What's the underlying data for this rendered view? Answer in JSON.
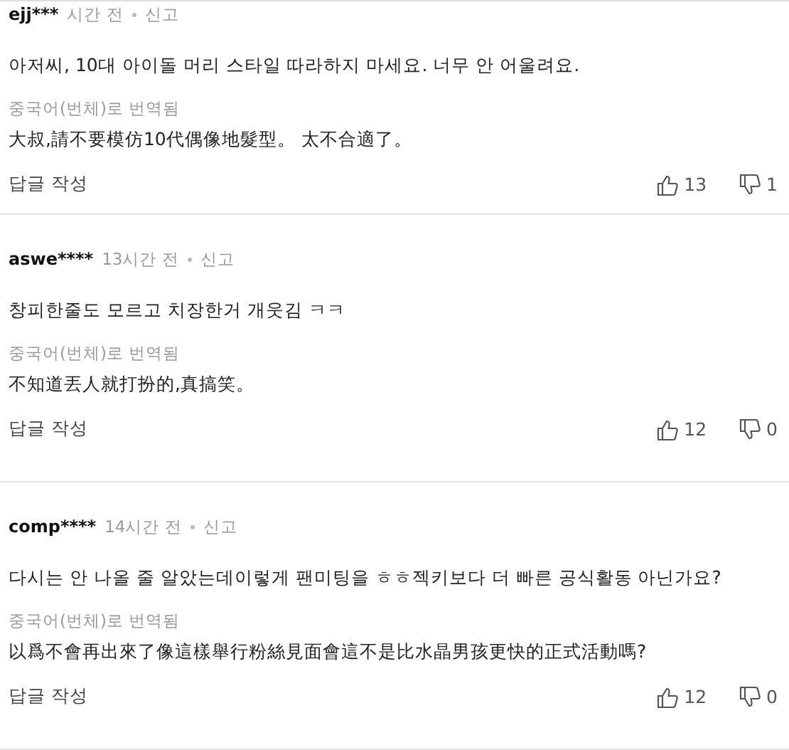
{
  "comments": [
    {
      "username": "ejj***",
      "time": "시간 전",
      "report": "신고",
      "body": "아저씨, 10대 아이돌 머리 스타일 따라하지 마세요. 너무 안 어울려요.",
      "translated_label": "중국어(번체)로 번역됨",
      "translation": "大叔,請不要模仿10代偶像地髮型。 太不合適了。",
      "reply": "답글 작성",
      "likes": "13",
      "dislikes": "1"
    },
    {
      "username": "aswe****",
      "time": "13시간 전",
      "report": "신고",
      "body": "창피한줄도 모르고 치장한거 개웃김 ㅋㅋ",
      "translated_label": "중국어(번체)로 번역됨",
      "translation": "不知道丟人就打扮的,真搞笑。",
      "reply": "답글 작성",
      "likes": "12",
      "dislikes": "0"
    },
    {
      "username": "comp****",
      "time": "14시간 전",
      "report": "신고",
      "body": "다시는 안 나올 줄 알았는데이렇게 팬미팅을 ㅎㅎ젝키보다 더 빠른 공식활동 아닌가요?",
      "translated_label": "중국어(번체)로 번역됨",
      "translation": "以爲不會再出來了像這樣舉行粉絲見面會這不是比水晶男孩更快的正式活動嗎?",
      "reply": "답글 작성",
      "likes": "12",
      "dislikes": "0"
    }
  ]
}
